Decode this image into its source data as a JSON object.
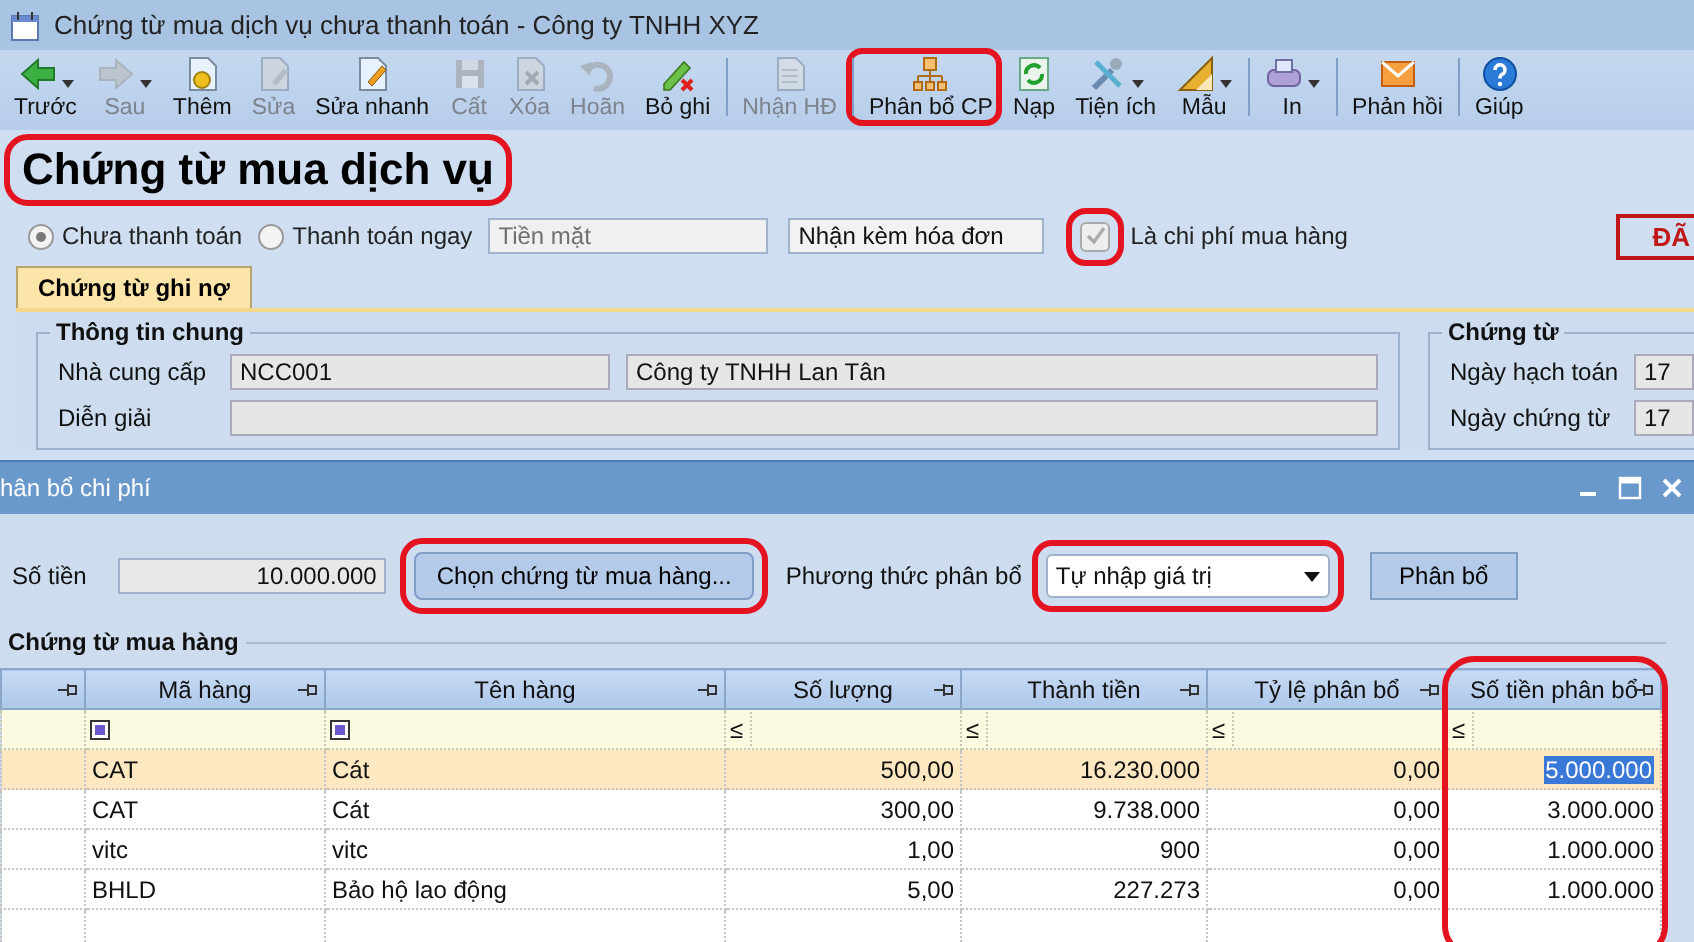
{
  "window": {
    "title": "Chứng từ mua dịch vụ chưa thanh toán - Công ty TNHH XYZ"
  },
  "toolbar": [
    {
      "label": "Trước",
      "disabled": false,
      "dropdown": true,
      "group_start": false,
      "highlighted": false
    },
    {
      "label": "Sau",
      "disabled": true,
      "dropdown": true,
      "group_start": false,
      "highlighted": false
    },
    {
      "label": "Thêm",
      "disabled": false,
      "dropdown": false,
      "group_start": false,
      "highlighted": false
    },
    {
      "label": "Sửa",
      "disabled": true,
      "dropdown": false,
      "group_start": false,
      "highlighted": false
    },
    {
      "label": "Sửa nhanh",
      "disabled": false,
      "dropdown": false,
      "group_start": false,
      "highlighted": false
    },
    {
      "label": "Cất",
      "disabled": true,
      "dropdown": false,
      "group_start": false,
      "highlighted": false
    },
    {
      "label": "Xóa",
      "disabled": true,
      "dropdown": false,
      "group_start": false,
      "highlighted": false
    },
    {
      "label": "Hoãn",
      "disabled": true,
      "dropdown": false,
      "group_start": false,
      "highlighted": false
    },
    {
      "label": "Bỏ ghi",
      "disabled": false,
      "dropdown": false,
      "group_start": false,
      "highlighted": false
    },
    {
      "label": "Nhận HĐ",
      "disabled": true,
      "dropdown": false,
      "group_start": true,
      "highlighted": false
    },
    {
      "label": "Phân bổ CP",
      "disabled": false,
      "dropdown": false,
      "group_start": true,
      "highlighted": true
    },
    {
      "label": "Nạp",
      "disabled": false,
      "dropdown": false,
      "group_start": false,
      "highlighted": false
    },
    {
      "label": "Tiện ích",
      "disabled": false,
      "dropdown": true,
      "group_start": false,
      "highlighted": false
    },
    {
      "label": "Mẫu",
      "disabled": false,
      "dropdown": true,
      "group_start": false,
      "highlighted": false
    },
    {
      "label": "In",
      "disabled": false,
      "dropdown": true,
      "group_start": true,
      "highlighted": false
    },
    {
      "label": "Phản hồi",
      "disabled": false,
      "dropdown": false,
      "group_start": true,
      "highlighted": false
    },
    {
      "label": "Giúp",
      "disabled": false,
      "dropdown": false,
      "group_start": true,
      "highlighted": false
    }
  ],
  "header": {
    "title": "Chứng từ mua dịch vụ",
    "highlighted": true
  },
  "payment_options": [
    {
      "label": "Chưa thanh toán",
      "selected": true
    },
    {
      "label": "Thanh toán ngay",
      "selected": false
    }
  ],
  "payment_method": {
    "value": "Tiền mặt",
    "disabled": true
  },
  "invoice_option": {
    "value": "Nhận kèm hóa đơn"
  },
  "purchase_cost": {
    "label": "Là chi phí mua hàng",
    "checked": true,
    "disabled": true,
    "highlighted": true
  },
  "stamp": "ĐÃ",
  "tabs": [
    {
      "label": "Chứng từ ghi nợ",
      "selected": true
    }
  ],
  "general_info": {
    "title": "Thông tin chung",
    "fields": [
      {
        "label": "Nhà cung cấp",
        "values": [
          "NCC001",
          "Công ty TNHH Lan Tân"
        ]
      },
      {
        "label": "Diễn giải"
      }
    ]
  },
  "voucher": {
    "title": "Chứng từ",
    "fields": [
      {
        "label": "Ngày hạch toán",
        "value": "17"
      },
      {
        "label": "Ngày chứng từ",
        "value": "17"
      }
    ]
  },
  "dialog": {
    "title": "hân bổ chi phí",
    "amount_label": "Số tiền",
    "amount": "10.000.000",
    "choose_button": {
      "label": "Chọn chứng từ mua hàng...",
      "highlighted": true
    },
    "method_label": "Phương thức phân bổ",
    "method": {
      "value": "Tự nhập giá trị",
      "highlighted": true
    },
    "allocate_button": "Phân bổ",
    "section_title": "Chứng từ mua hàng",
    "table": {
      "columns": [
        {
          "label": "Mã hàng",
          "highlighted": false
        },
        {
          "label": "Tên hàng",
          "highlighted": false
        },
        {
          "label": "Số lượng",
          "highlighted": false
        },
        {
          "label": "Thành tiền",
          "highlighted": false
        },
        {
          "label": "Tỷ lệ phân bổ",
          "highlighted": false
        },
        {
          "label": "Số tiền phân bổ",
          "highlighted": true
        }
      ],
      "filter": [
        {
          "kind": "check"
        },
        {
          "kind": "check"
        },
        {
          "kind": "operator",
          "text": "≤"
        },
        {
          "kind": "operator",
          "text": "≤"
        },
        {
          "kind": "operator",
          "text": "≤"
        },
        {
          "kind": "operator",
          "text": "≤"
        }
      ],
      "rows": [
        {
          "cells": [
            "CAT",
            "Cát",
            "500,00",
            "16.230.000",
            "0,00",
            "5.000.000"
          ],
          "selected": true
        },
        {
          "cells": [
            "CAT",
            "Cát",
            "300,00",
            "9.738.000",
            "0,00",
            "3.000.000"
          ],
          "selected": false
        },
        {
          "cells": [
            "vitc",
            "vitc",
            "1,00",
            "900",
            "0,00",
            "1.000.000"
          ],
          "selected": false
        },
        {
          "cells": [
            "BHLD",
            "Bảo hộ lao động",
            "5,00",
            "227.273",
            "0,00",
            "1.000.000"
          ],
          "selected": false
        }
      ]
    }
  }
}
